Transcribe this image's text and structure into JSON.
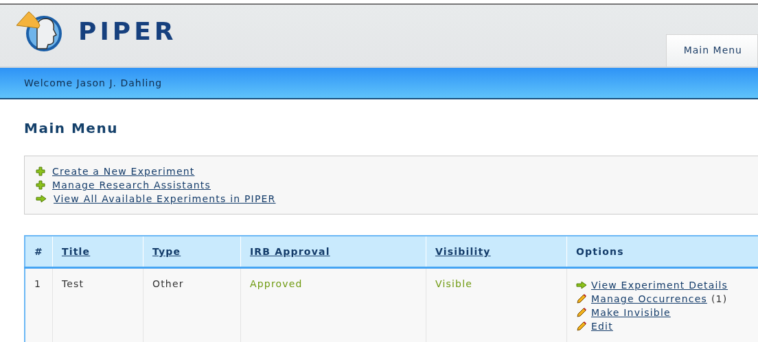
{
  "header": {
    "logo_text": "PIPER",
    "tabs": [
      {
        "label": "Main Menu",
        "selected": true
      }
    ]
  },
  "welcome": "Welcome Jason J. Dahling",
  "page_title": "Main Menu",
  "actions": [
    {
      "kind": "plus",
      "label": "Create a New Experiment"
    },
    {
      "kind": "plus",
      "label": "Manage Research Assistants"
    },
    {
      "kind": "arrow",
      "label": "View All Available Experiments in PIPER"
    }
  ],
  "table": {
    "columns": [
      {
        "label": "#",
        "sortable": false
      },
      {
        "label": "Title",
        "sortable": true
      },
      {
        "label": "Type",
        "sortable": true
      },
      {
        "label": "IRB Approval",
        "sortable": true
      },
      {
        "label": "Visibility",
        "sortable": true
      },
      {
        "label": "Options",
        "sortable": false
      }
    ],
    "rows": [
      {
        "number": "1",
        "title": "Test",
        "type": "Other",
        "irb_approval": "Approved",
        "visibility": "Visible",
        "options": [
          {
            "kind": "arrow",
            "label": "View Experiment Details"
          },
          {
            "kind": "pencil",
            "label": "Manage Occurrences",
            "count": "(1)"
          },
          {
            "kind": "pencil",
            "label": "Make Invisible"
          },
          {
            "kind": "pencil",
            "label": "Edit"
          }
        ]
      }
    ]
  }
}
